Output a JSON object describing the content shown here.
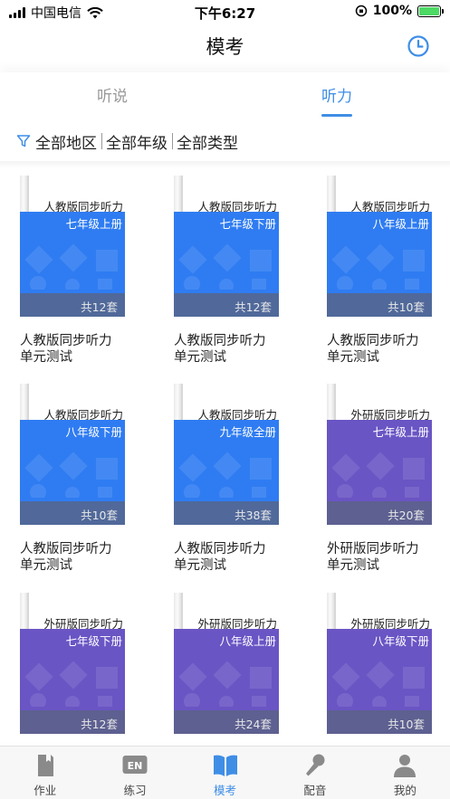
{
  "status_bar": {
    "carrier": "中国电信",
    "time": "下午6:27",
    "battery": "100%"
  },
  "nav": {
    "title": "模考",
    "history_icon": "clock-icon"
  },
  "tabs": [
    {
      "label": "听说",
      "active": false
    },
    {
      "label": "听力",
      "active": true
    }
  ],
  "filters": [
    "全部地区",
    "全部年级",
    "全部类型"
  ],
  "colors": {
    "accent": "#3f8ee6",
    "cover_blue": "#2f7cf2",
    "cover_purple": "#6a55c4"
  },
  "cards": [
    {
      "series": "人教版同步听力",
      "grade": "七年级上册",
      "count": "共12套",
      "title": [
        "人教版同步听力",
        "单元测试"
      ],
      "color": "blue"
    },
    {
      "series": "人教版同步听力",
      "grade": "七年级下册",
      "count": "共12套",
      "title": [
        "人教版同步听力",
        "单元测试"
      ],
      "color": "blue"
    },
    {
      "series": "人教版同步听力",
      "grade": "八年级上册",
      "count": "共10套",
      "title": [
        "人教版同步听力",
        "单元测试"
      ],
      "color": "blue"
    },
    {
      "series": "人教版同步听力",
      "grade": "八年级下册",
      "count": "共10套",
      "title": [
        "人教版同步听力",
        "单元测试"
      ],
      "color": "blue"
    },
    {
      "series": "人教版同步听力",
      "grade": "九年级全册",
      "count": "共38套",
      "title": [
        "人教版同步听力",
        "单元测试"
      ],
      "color": "blue"
    },
    {
      "series": "外研版同步听力",
      "grade": "七年级上册",
      "count": "共20套",
      "title": [
        "外研版同步听力",
        "单元测试"
      ],
      "color": "purple"
    },
    {
      "series": "外研版同步听力",
      "grade": "七年级下册",
      "count": "共12套",
      "title": [
        "",
        ""
      ],
      "color": "purple"
    },
    {
      "series": "外研版同步听力",
      "grade": "八年级上册",
      "count": "共24套",
      "title": [
        "",
        ""
      ],
      "color": "purple"
    },
    {
      "series": "外研版同步听力",
      "grade": "八年级下册",
      "count": "共10套",
      "title": [
        "",
        ""
      ],
      "color": "purple"
    }
  ],
  "bottom_tabs": [
    {
      "label": "作业",
      "icon": "homework-icon",
      "active": false
    },
    {
      "label": "练习",
      "icon": "practice-en-icon",
      "active": false
    },
    {
      "label": "模考",
      "icon": "book-open-icon",
      "active": true
    },
    {
      "label": "配音",
      "icon": "microphone-icon",
      "active": false
    },
    {
      "label": "我的",
      "icon": "user-icon",
      "active": false
    }
  ]
}
